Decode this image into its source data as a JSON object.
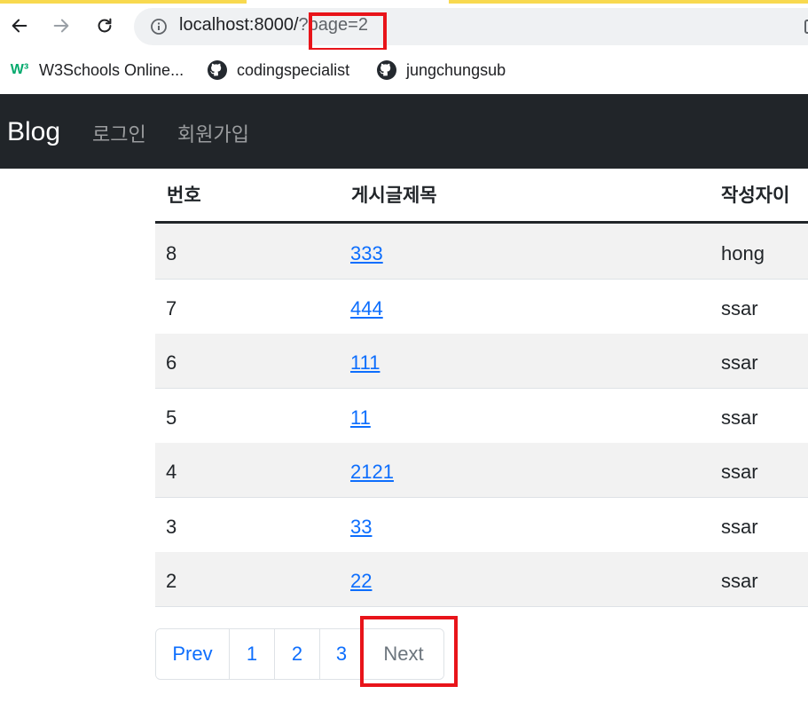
{
  "browser": {
    "url_host": "localhost:8000/",
    "url_query": "?page=2",
    "bookmarks": [
      {
        "label": "W3Schools Online...",
        "icon": "w3schools-icon"
      },
      {
        "label": "codingspecialist",
        "icon": "github-icon"
      },
      {
        "label": "jungchungsub",
        "icon": "github-icon"
      }
    ]
  },
  "navbar": {
    "brand": "Blog",
    "links": [
      "로그인",
      "회원가입"
    ]
  },
  "table": {
    "headers": [
      "번호",
      "게시글제목",
      "작성자이"
    ],
    "rows": [
      {
        "id": "8",
        "title": "333",
        "author": "hong"
      },
      {
        "id": "7",
        "title": "444",
        "author": "ssar"
      },
      {
        "id": "6",
        "title": "111",
        "author": "ssar"
      },
      {
        "id": "5",
        "title": "11",
        "author": "ssar"
      },
      {
        "id": "4",
        "title": "2121",
        "author": "ssar"
      },
      {
        "id": "3",
        "title": "33",
        "author": "ssar"
      },
      {
        "id": "2",
        "title": "22",
        "author": "ssar"
      }
    ]
  },
  "pagination": {
    "prev": "Prev",
    "pages": [
      "1",
      "2",
      "3"
    ],
    "next": "Next"
  },
  "colors": {
    "navbar_bg": "#212529",
    "link": "#0d6efd",
    "highlight": "#e8141a"
  }
}
